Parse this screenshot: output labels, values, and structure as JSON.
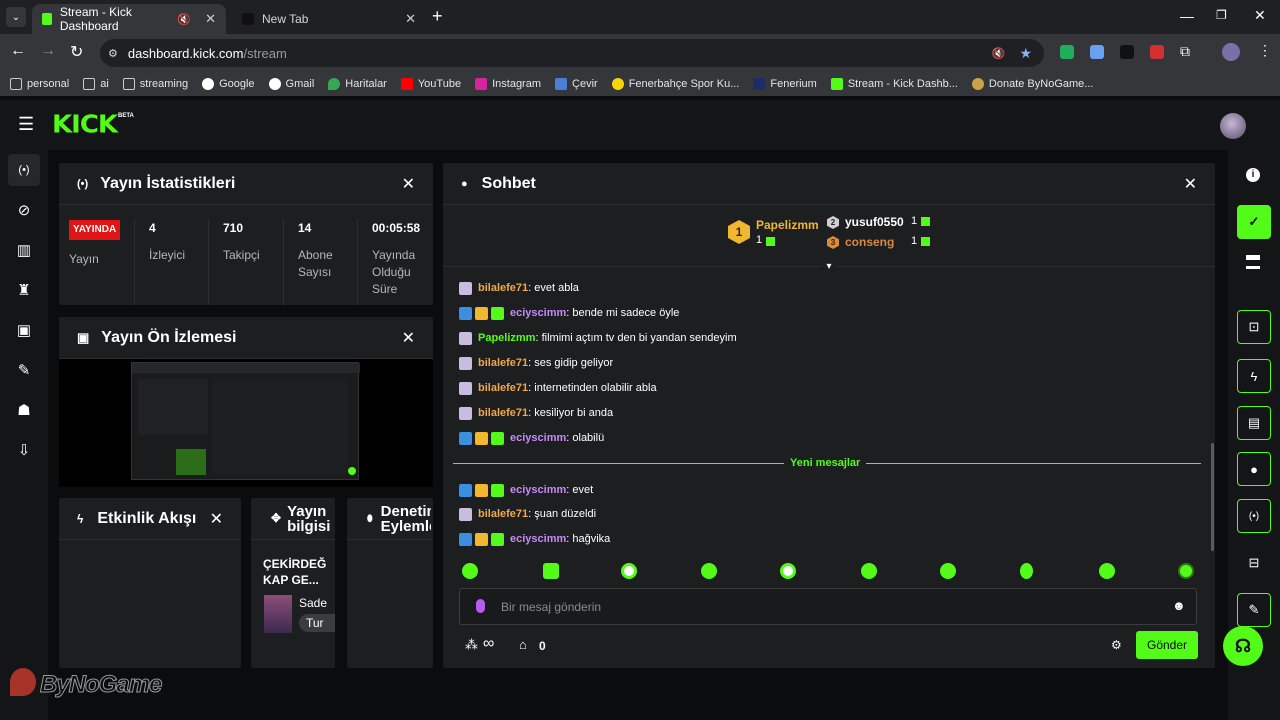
{
  "browser": {
    "tabs": [
      {
        "title": "Stream - Kick Dashboard",
        "active": true
      },
      {
        "title": "New Tab",
        "active": false
      }
    ],
    "url_domain": "dashboard.kick.com",
    "url_path": "/stream",
    "bookmarks": [
      "personal",
      "ai",
      "streaming",
      "Google",
      "Gmail",
      "Haritalar",
      "YouTube",
      "Instagram",
      "Çevir",
      "Fenerbahçe Spor Ku...",
      "Fenerium",
      "Stream - Kick Dashb...",
      "Donate ByNoGame..."
    ]
  },
  "kick": {
    "logo": "KICK",
    "beta": "BETA",
    "accent": "#53fc18"
  },
  "stats_panel": {
    "title": "Yayın İstatistikleri",
    "live_badge": "YAYINDA",
    "live_label": "Yayın",
    "stats": [
      {
        "value": "4",
        "label": "İzleyici"
      },
      {
        "value": "710",
        "label": "Takipçi"
      },
      {
        "value": "14",
        "label": "Abone Sayısı"
      },
      {
        "value": "00:05:58",
        "label": "Yayında Olduğu Süre"
      }
    ]
  },
  "preview_panel": {
    "title": "Yayın Ön İzlemesi"
  },
  "activity_panel": {
    "title": "Etkinlik Akışı"
  },
  "info_panel": {
    "title": "Yayın bilgisi",
    "stream_title": "ÇEKİRDEĞ KAP GE...",
    "item_name": "Sade",
    "item_tag": "Tur"
  },
  "mod_panel": {
    "title": "Denetim Eylemle"
  },
  "chat": {
    "title": "Sohbet",
    "leaderboard": [
      {
        "rank": "1",
        "name": "Papelizmm",
        "count": "1"
      },
      {
        "rank": "2",
        "name": "yusuf0550",
        "count": "1"
      },
      {
        "rank": "3",
        "name": "conseng",
        "count": "1"
      }
    ],
    "messages": [
      {
        "user": "bilalefe71",
        "text": ": evet abla",
        "color": "#f0a848"
      },
      {
        "user": "eciyscimm",
        "text": ": bende mi sadece öyle",
        "color": "#c58af9"
      },
      {
        "user": "Papelizmm",
        "text": ": filmimi açtım tv den bi yandan sendeyim",
        "color": "#53fc18"
      },
      {
        "user": "bilalefe71",
        "text": ": ses gidip geliyor",
        "color": "#f0a848"
      },
      {
        "user": "bilalefe71",
        "text": ": internetinden olabilir abla",
        "color": "#f0a848"
      },
      {
        "user": "bilalefe71",
        "text": ": kesiliyor bi anda",
        "color": "#f0a848"
      },
      {
        "user": "eciyscimm",
        "text": ": olabilü",
        "color": "#c58af9"
      },
      {
        "user": "eciyscimm",
        "text": ": evet",
        "color": "#c58af9"
      },
      {
        "user": "bilalefe71",
        "text": ": şuan düzeldi",
        "color": "#f0a848"
      },
      {
        "user": "eciyscimm",
        "text": ": hağvika",
        "color": "#c58af9"
      }
    ],
    "new_messages": "Yeni mesajlar",
    "input_placeholder": "Bir mesaj gönderin",
    "points": "∞",
    "store_count": "0",
    "send": "Gönder"
  },
  "watermark": "ByNoGame"
}
